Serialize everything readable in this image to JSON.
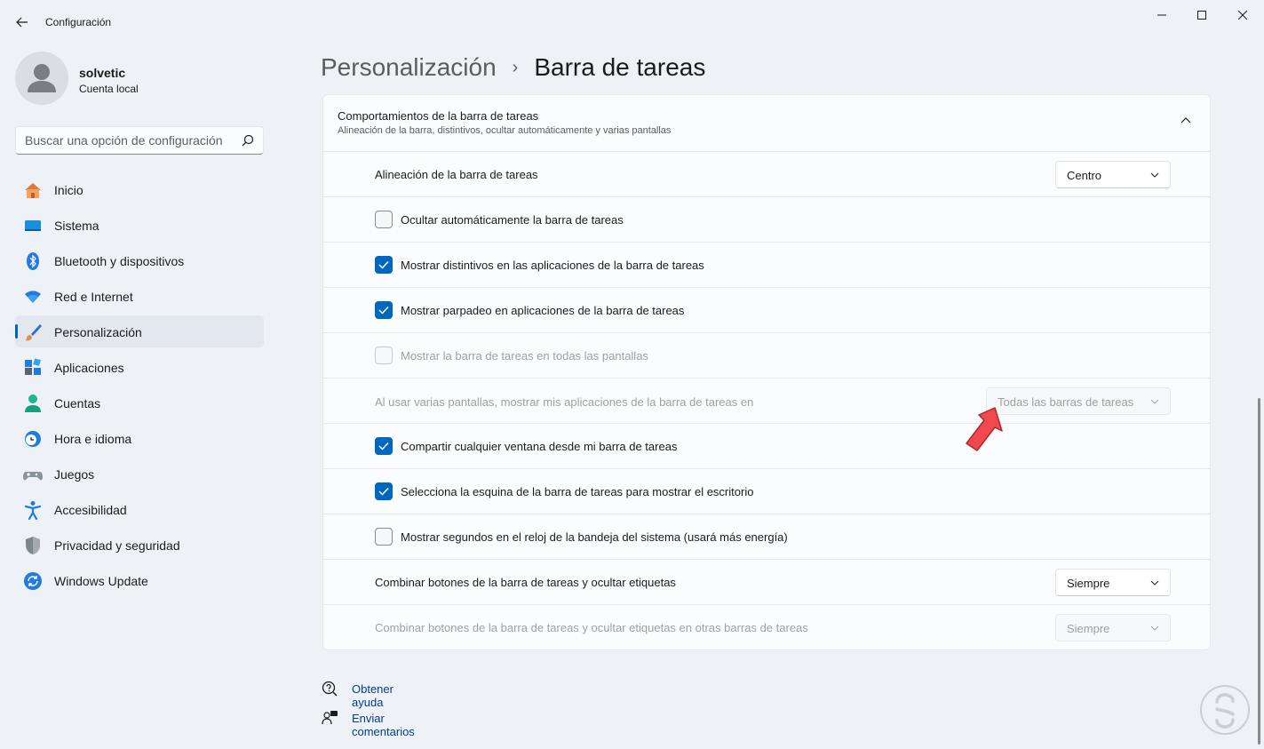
{
  "window": {
    "title": "Configuración",
    "controls": [
      "minimize-icon",
      "maximize-icon",
      "close-icon"
    ]
  },
  "user": {
    "name": "solvetic",
    "account_type": "Cuenta local"
  },
  "search": {
    "placeholder": "Buscar una opción de configuración"
  },
  "sidebar": {
    "items": [
      {
        "label": "Inicio",
        "icon": "home-icon",
        "active": false
      },
      {
        "label": "Sistema",
        "icon": "system-icon",
        "active": false
      },
      {
        "label": "Bluetooth y dispositivos",
        "icon": "bluetooth-icon",
        "active": false
      },
      {
        "label": "Red e Internet",
        "icon": "wifi-icon",
        "active": false
      },
      {
        "label": "Personalización",
        "icon": "brush-icon",
        "active": true
      },
      {
        "label": "Aplicaciones",
        "icon": "apps-icon",
        "active": false
      },
      {
        "label": "Cuentas",
        "icon": "accounts-icon",
        "active": false
      },
      {
        "label": "Hora e idioma",
        "icon": "clock-globe-icon",
        "active": false
      },
      {
        "label": "Juegos",
        "icon": "gamepad-icon",
        "active": false
      },
      {
        "label": "Accesibilidad",
        "icon": "accessibility-icon",
        "active": false
      },
      {
        "label": "Privacidad y seguridad",
        "icon": "shield-icon",
        "active": false
      },
      {
        "label": "Windows Update",
        "icon": "update-icon",
        "active": false
      }
    ]
  },
  "breadcrumb": {
    "parent": "Personalización",
    "separator": "›",
    "current": "Barra de tareas"
  },
  "section": {
    "title": "Comportamientos de la barra de tareas",
    "subtitle": "Alineación de la barra, distintivos, ocultar automáticamente y varias pantallas",
    "rows": [
      {
        "kind": "dropdown",
        "label": "Alineación de la barra de tareas",
        "value": "Centro",
        "disabled": false
      },
      {
        "kind": "checkbox",
        "label": "Ocultar automáticamente la barra de tareas",
        "checked": false,
        "disabled": false
      },
      {
        "kind": "checkbox",
        "label": "Mostrar distintivos en las aplicaciones de la barra de tareas",
        "checked": true,
        "disabled": false
      },
      {
        "kind": "checkbox",
        "label": "Mostrar parpadeo en aplicaciones de la barra de tareas",
        "checked": true,
        "disabled": false
      },
      {
        "kind": "checkbox",
        "label": "Mostrar la barra de tareas en todas las pantallas",
        "checked": false,
        "disabled": true
      },
      {
        "kind": "dropdown",
        "label": "Al usar varias pantallas, mostrar mis aplicaciones de la barra de tareas en",
        "value": "Todas las barras de tareas",
        "disabled": true
      },
      {
        "kind": "checkbox",
        "label": "Compartir cualquier ventana desde mi barra de tareas",
        "checked": true,
        "disabled": false
      },
      {
        "kind": "checkbox",
        "label": "Selecciona la esquina de la barra de tareas para mostrar el escritorio",
        "checked": true,
        "disabled": false
      },
      {
        "kind": "checkbox",
        "label": "Mostrar segundos en el reloj de la bandeja del sistema (usará más energía)",
        "checked": false,
        "disabled": false
      },
      {
        "kind": "dropdown",
        "label": "Combinar botones de la barra de tareas y ocultar etiquetas",
        "value": "Siempre",
        "disabled": false
      },
      {
        "kind": "dropdown",
        "label": "Combinar botones de la barra de tareas y ocultar etiquetas en otras barras de tareas",
        "value": "Siempre",
        "disabled": true
      }
    ]
  },
  "help": {
    "get_help": "Obtener ayuda",
    "feedback": "Enviar comentarios"
  },
  "colors": {
    "accent": "#0067c0",
    "pointer_arrow": "#f0484f"
  }
}
